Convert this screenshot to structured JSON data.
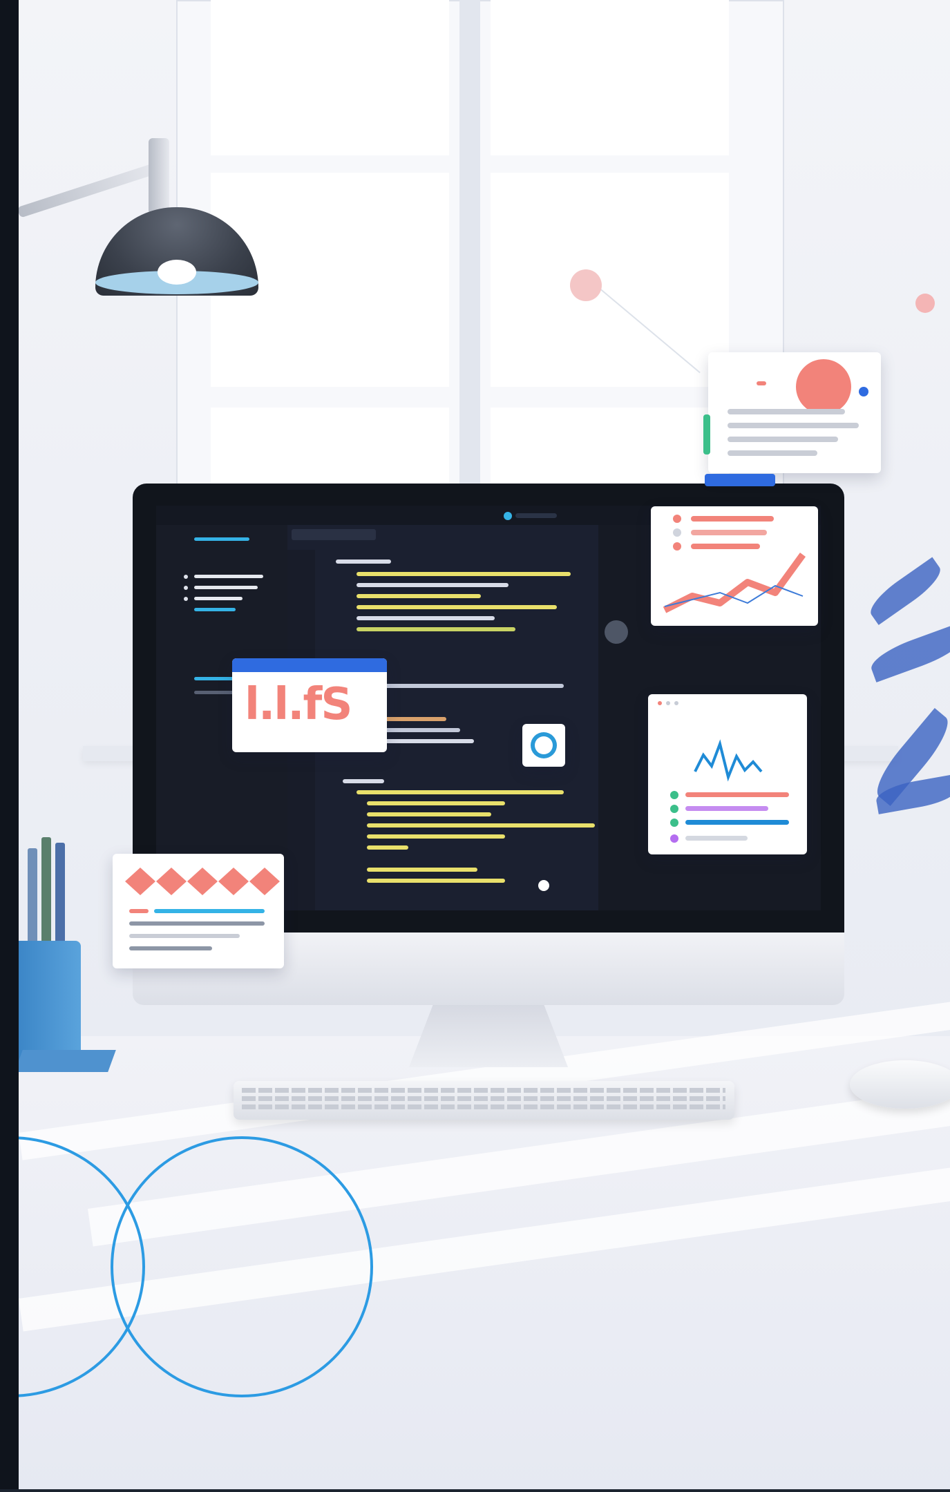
{
  "scene": {
    "description_colors": {
      "accent_blue": "#2c9be3",
      "coral": "#f2837a",
      "screen_dark": "#1a1f2b",
      "wall": "#eef0f6"
    },
    "logo_text": "l.l.fS"
  }
}
